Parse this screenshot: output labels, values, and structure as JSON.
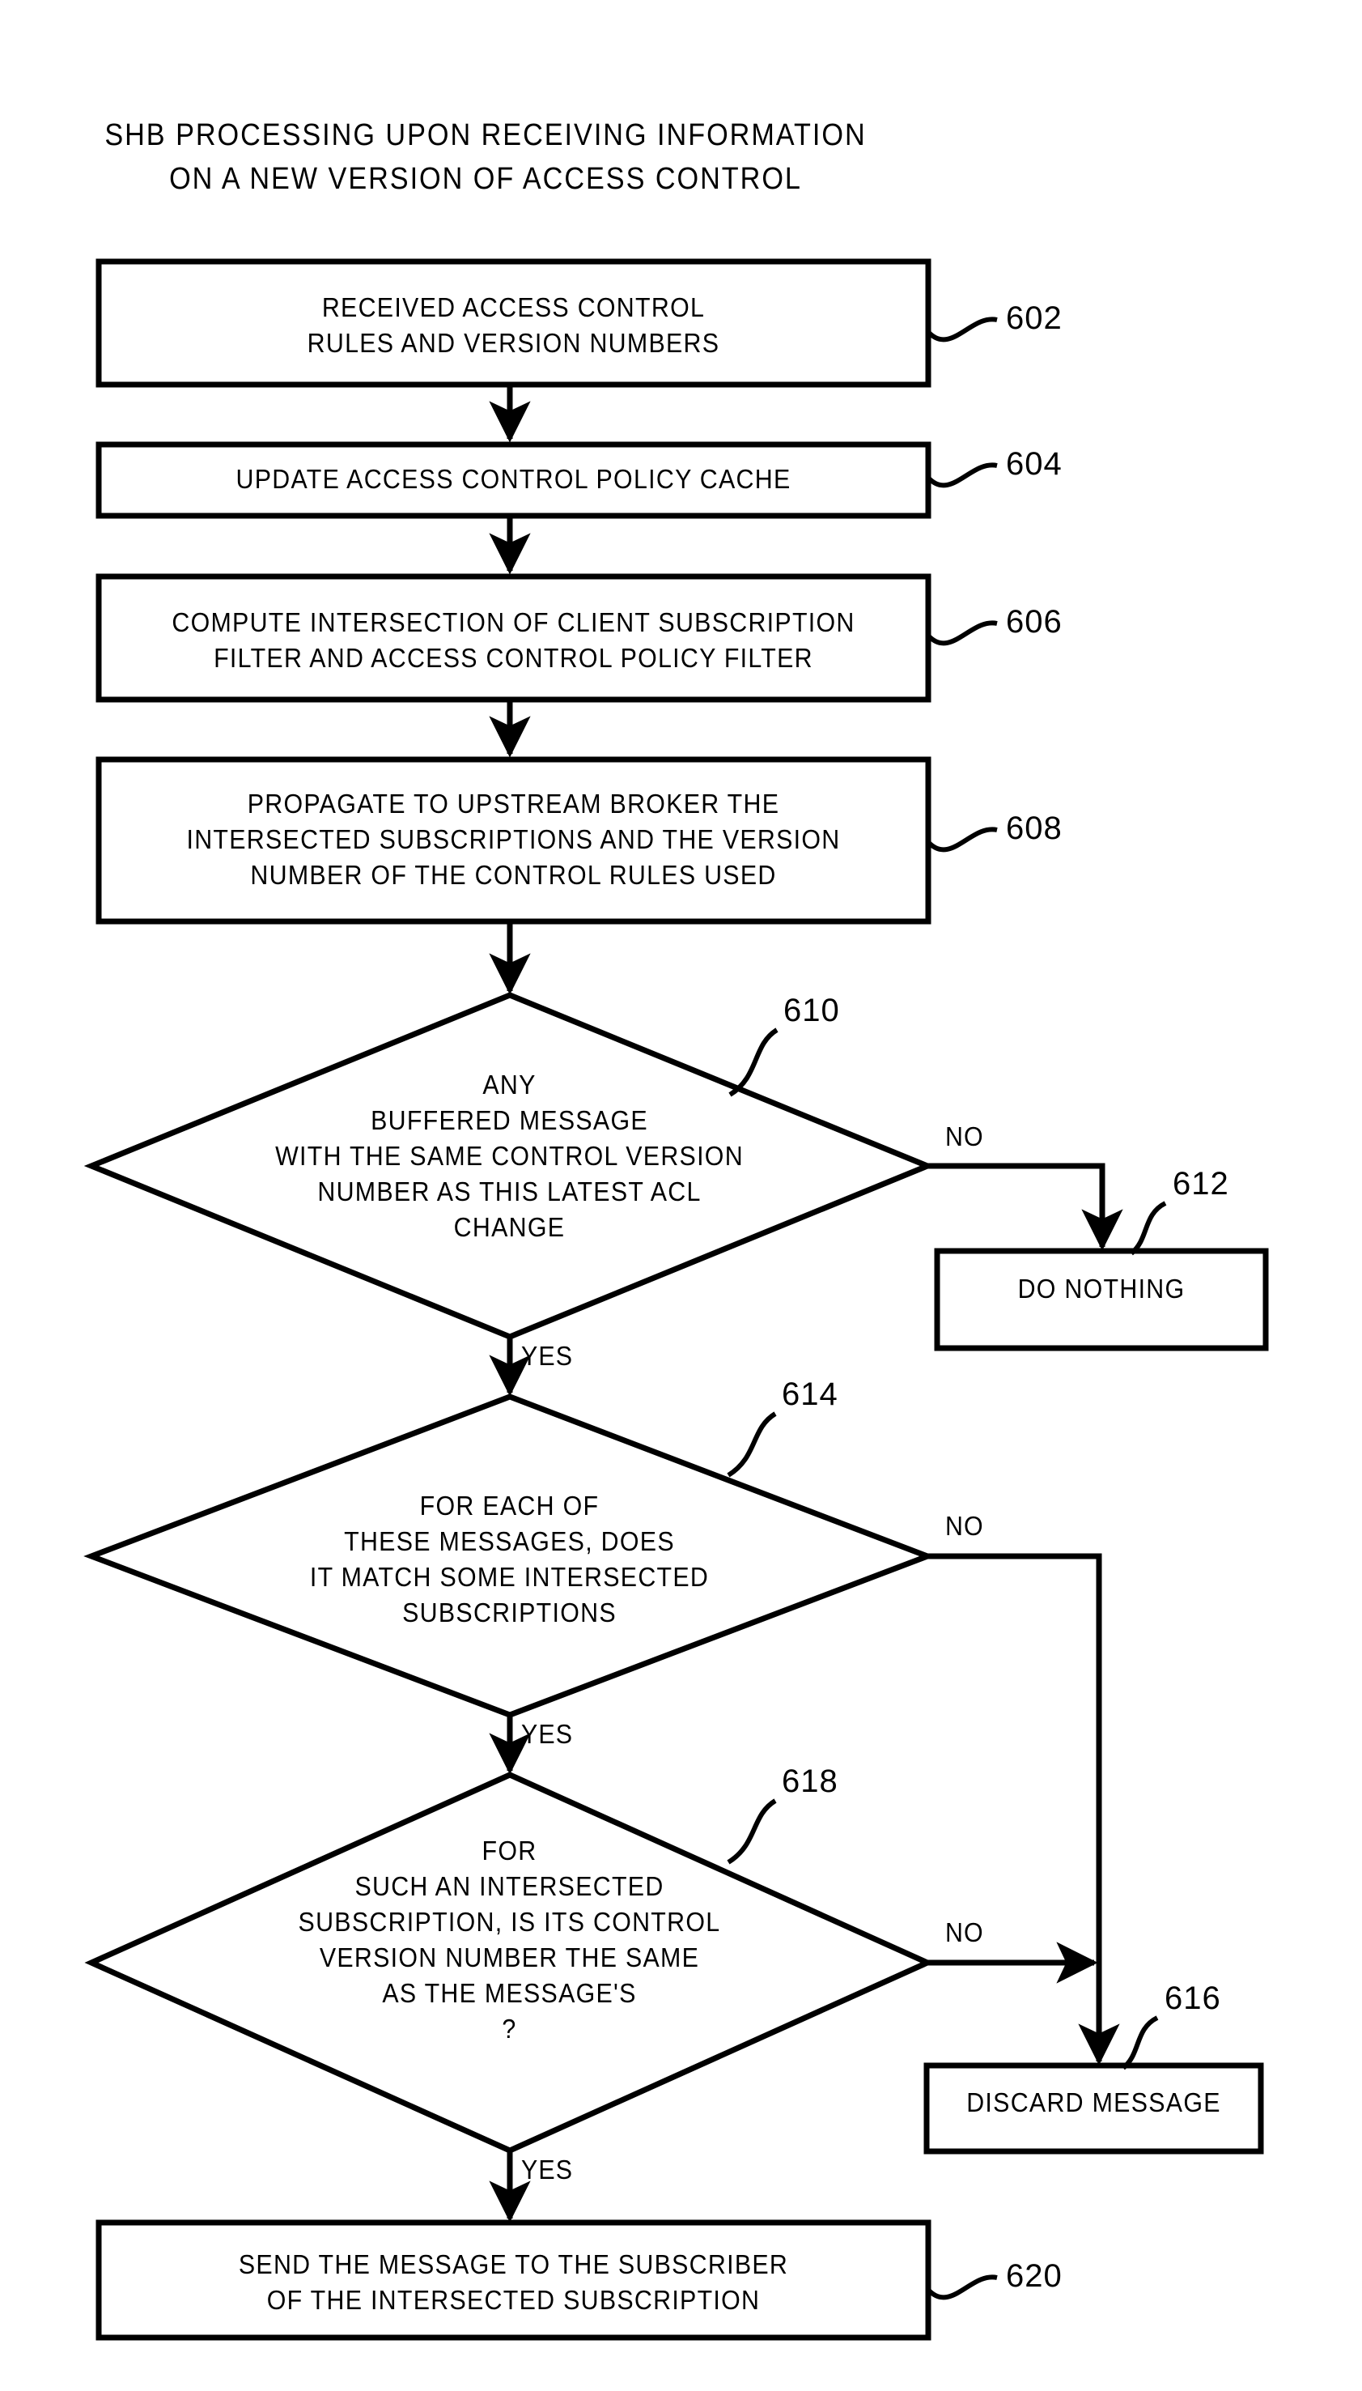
{
  "figure": {
    "title_lines": [
      "SHB PROCESSING UPON RECEIVING INFORMATION",
      "ON A NEW VERSION OF ACCESS CONTROL"
    ]
  },
  "nodes": {
    "n602": {
      "ref": "602",
      "shape": "process",
      "lines": [
        "RECEIVED ACCESS CONTROL",
        "RULES AND VERSION NUMBERS"
      ]
    },
    "n604": {
      "ref": "604",
      "shape": "process",
      "lines": [
        "UPDATE ACCESS CONTROL POLICY CACHE"
      ]
    },
    "n606": {
      "ref": "606",
      "shape": "process",
      "lines": [
        "COMPUTE INTERSECTION OF CLIENT SUBSCRIPTION",
        "FILTER AND ACCESS CONTROL POLICY FILTER"
      ]
    },
    "n608": {
      "ref": "608",
      "shape": "process",
      "lines": [
        "PROPAGATE TO UPSTREAM BROKER THE",
        "INTERSECTED SUBSCRIPTIONS AND THE VERSION",
        "NUMBER OF THE CONTROL RULES USED"
      ]
    },
    "n610": {
      "ref": "610",
      "shape": "decision",
      "lines": [
        "ANY",
        "BUFFERED MESSAGE",
        "WITH THE SAME CONTROL VERSION",
        "NUMBER AS THIS LATEST ACL",
        "CHANGE"
      ]
    },
    "n612": {
      "ref": "612",
      "shape": "process",
      "lines": [
        "DO NOTHING"
      ]
    },
    "n614": {
      "ref": "614",
      "shape": "decision",
      "lines": [
        "FOR EACH OF",
        "THESE MESSAGES, DOES",
        "IT MATCH SOME INTERSECTED",
        "SUBSCRIPTIONS"
      ]
    },
    "n618": {
      "ref": "618",
      "shape": "decision",
      "lines": [
        "FOR",
        "SUCH AN INTERSECTED",
        "SUBSCRIPTION, IS ITS CONTROL",
        "VERSION NUMBER THE SAME",
        "AS THE MESSAGE'S",
        "?"
      ]
    },
    "n616": {
      "ref": "616",
      "shape": "process",
      "lines": [
        "DISCARD MESSAGE"
      ]
    },
    "n620": {
      "ref": "620",
      "shape": "process",
      "lines": [
        "SEND THE MESSAGE TO THE SUBSCRIBER",
        "OF THE INTERSECTED SUBSCRIPTION"
      ]
    }
  },
  "edge_labels": {
    "e610_no": "NO",
    "e610_yes": "YES",
    "e614_no": "NO",
    "e614_yes": "YES",
    "e618_no": "NO",
    "e618_yes": "YES"
  },
  "style": {
    "ink": "#000000",
    "paper": "#ffffff"
  }
}
